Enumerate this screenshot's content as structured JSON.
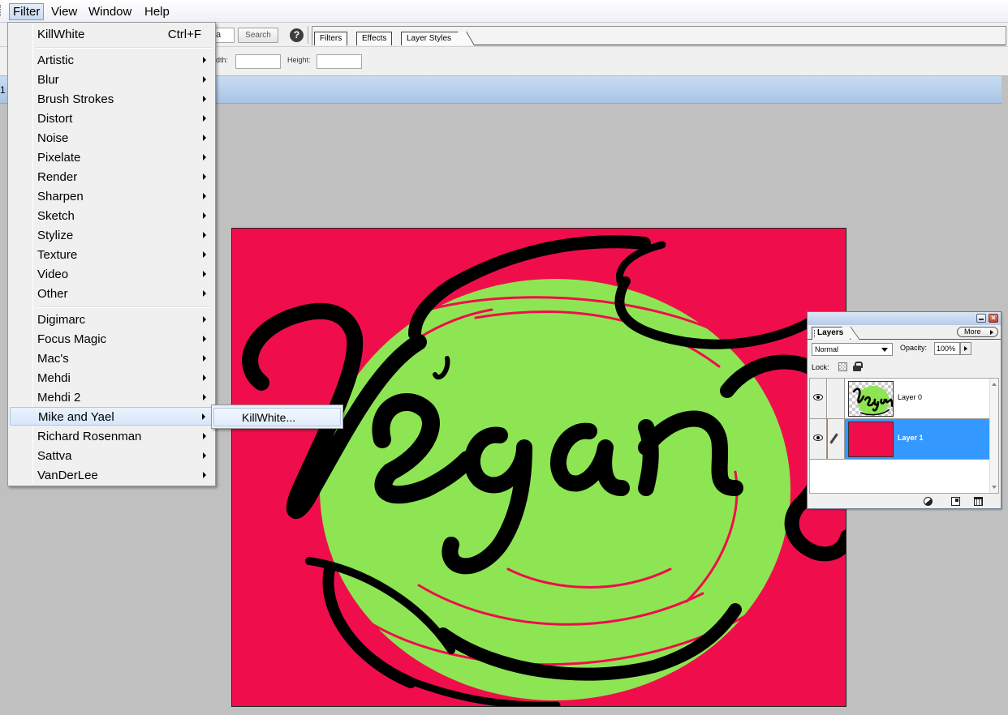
{
  "menubar": {
    "items": [
      {
        "label": "Filter",
        "active": true
      },
      {
        "label": "View"
      },
      {
        "label": "Window"
      },
      {
        "label": "Help"
      }
    ]
  },
  "options": {
    "search_fragment": "a",
    "search_label": "Search",
    "palette_tabs": [
      "Filters",
      "Effects",
      "Layer Styles"
    ],
    "width_label": "dth:",
    "height_label": "Height:"
  },
  "document": {
    "title_fragment": "1"
  },
  "filter_menu": {
    "last_filter": {
      "label": "KillWhite",
      "shortcut": "Ctrl+F"
    },
    "group1": [
      "Artistic",
      "Blur",
      "Brush Strokes",
      "Distort",
      "Noise",
      "Pixelate",
      "Render",
      "Sharpen",
      "Sketch",
      "Stylize",
      "Texture",
      "Video",
      "Other"
    ],
    "group2": [
      "Digimarc",
      "Focus Magic",
      "Mac's",
      "Mehdi",
      "Mehdi 2",
      "Mike and Yael",
      "Richard Rosenman",
      "Sattva",
      "VanDerLee"
    ],
    "highlighted": "Mike and Yael",
    "submenu": {
      "items": [
        "KillWhite..."
      ]
    }
  },
  "layers_panel": {
    "tab_label": "Layers",
    "more_label": "More",
    "blend_mode": "Normal",
    "opacity_label": "Opacity:",
    "opacity_value": "100%",
    "lock_label": "Lock:",
    "layers": [
      {
        "name": "Layer 0",
        "selected": false,
        "thumb": "vegan-art"
      },
      {
        "name": "Layer 1",
        "selected": true,
        "thumb": "pink-fill"
      }
    ]
  },
  "canvas": {
    "artwork_text": "Vegan",
    "colors": {
      "background": "#ef0e4b",
      "circle": "#8ee553",
      "lettering": "#000000"
    }
  },
  "colors": {
    "menu_highlight": "#d7e6fa",
    "layer_selected": "#3399ff",
    "doc_strip": "#b7cfee"
  }
}
